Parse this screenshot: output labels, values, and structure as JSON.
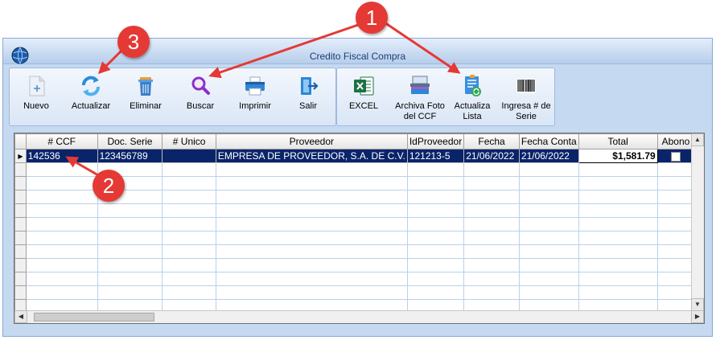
{
  "window": {
    "title": "Credito Fiscal Compra"
  },
  "toolbar_main": [
    {
      "label": "Nuevo",
      "icon": "new-document-icon"
    },
    {
      "label": "Actualizar",
      "icon": "refresh-icon"
    },
    {
      "label": "Eliminar",
      "icon": "trash-icon"
    },
    {
      "label": "Buscar",
      "icon": "search-icon"
    },
    {
      "label": "Imprimir",
      "icon": "printer-icon"
    },
    {
      "label": "Salir",
      "icon": "exit-icon"
    }
  ],
  "toolbar_extra": [
    {
      "label": "EXCEL",
      "icon": "excel-icon"
    },
    {
      "label": "Archiva Foto del CCF",
      "icon": "scanner-icon"
    },
    {
      "label": "Actualiza Lista",
      "icon": "update-list-icon"
    },
    {
      "label": "Ingresa # de Serie",
      "icon": "barcode-icon"
    }
  ],
  "grid": {
    "columns": [
      "# CCF",
      "Doc. Serie",
      "# Unico",
      "Proveedor",
      "IdProveedor",
      "Fecha",
      "Fecha Conta",
      "Total",
      "Abono",
      "#"
    ],
    "rows": [
      {
        "ccf": "142536",
        "doc_serie": "123456789",
        "unico": "",
        "proveedor": "EMPRESA DE PROVEEDOR, S.A. DE C.V.",
        "id_proveedor": "121213-5",
        "fecha": "21/06/2022",
        "fecha_conta": "21/06/2022",
        "total": "$1,581.79",
        "abono": false
      }
    ]
  },
  "callouts": [
    "1",
    "2",
    "3"
  ],
  "colors": {
    "callout": "#e53935",
    "selected_row": "#0a246a",
    "window_bg": "#c5d9f1"
  }
}
